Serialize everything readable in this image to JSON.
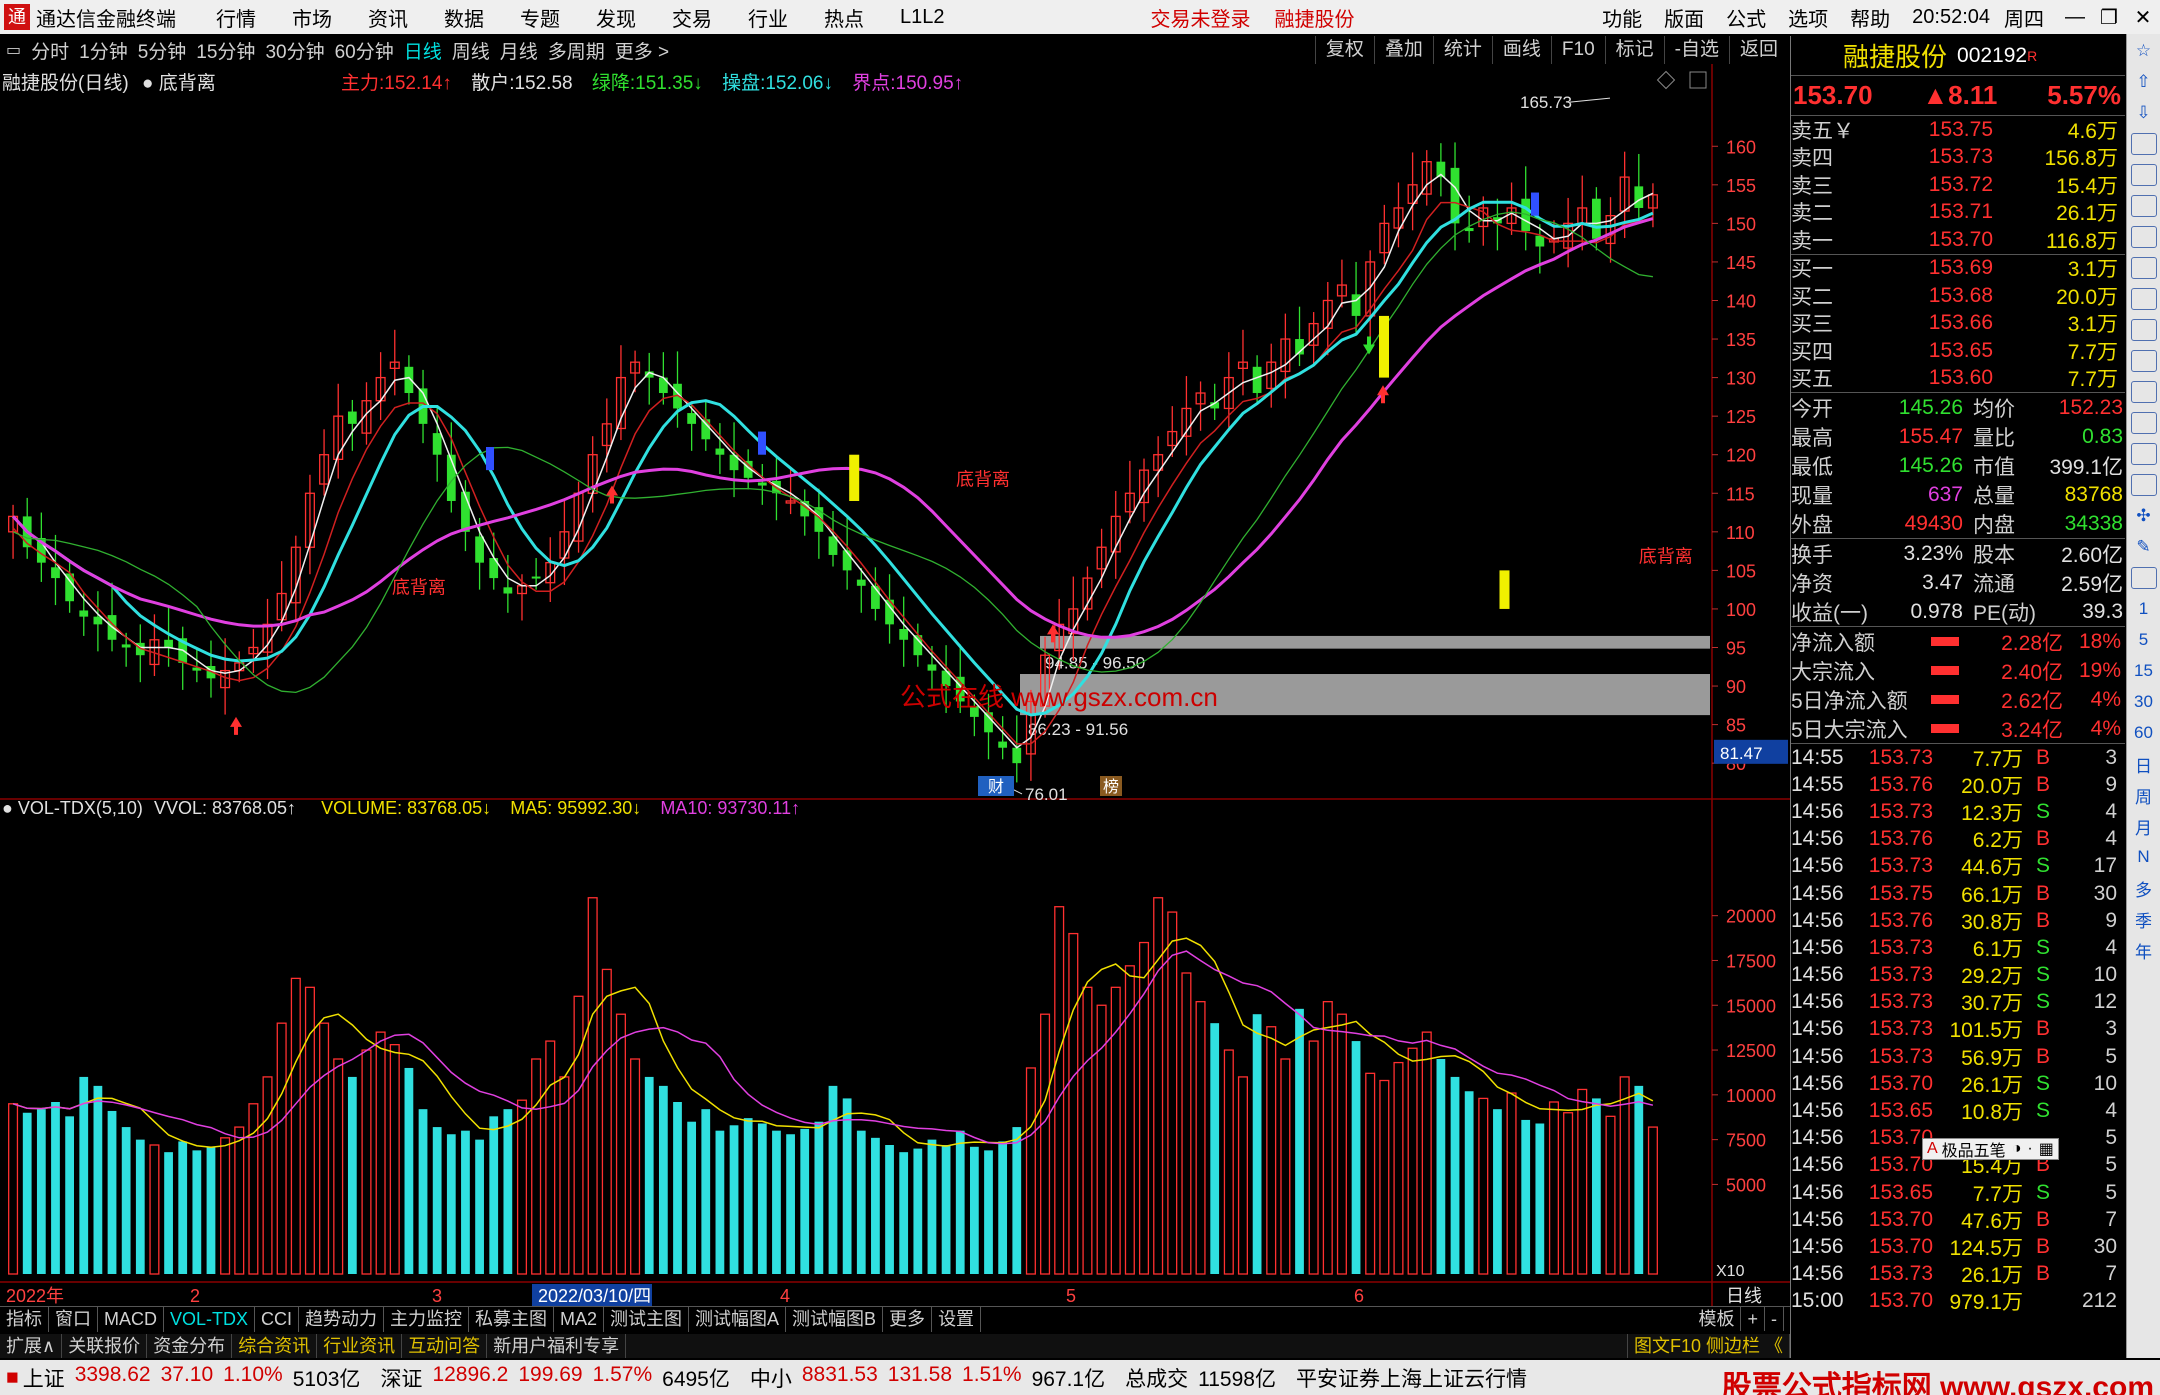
{
  "app_title": "通达信金融终端",
  "menu": [
    "行情",
    "市场",
    "资讯",
    "数据",
    "专题",
    "发现",
    "交易",
    "行业",
    "热点",
    "L1L2"
  ],
  "status_login": "交易未登录",
  "stock_short": "融捷股份",
  "top_right_menu": [
    "功能",
    "版面",
    "公式",
    "选项",
    "帮助"
  ],
  "clock": "20:52:04",
  "weekday": "周四",
  "window_buttons": [
    "—",
    "❐",
    "✕"
  ],
  "periods": [
    "分时",
    "1分钟",
    "5分钟",
    "15分钟",
    "30分钟",
    "60分钟",
    "日线",
    "周线",
    "月线",
    "多周期",
    "更多 >"
  ],
  "active_period": "日线",
  "chart_tools": [
    "复权",
    "叠加",
    "统计",
    "画线",
    "F10",
    "标记",
    "-自选",
    "返回"
  ],
  "main_legend": {
    "title": "融捷股份(日线)",
    "indicator": "底背离",
    "zl_label": "主力:",
    "zl_value": "152.14↑",
    "sh_label": "散户:",
    "sh_value": "152.58",
    "lj_label": "绿降:",
    "lj_value": "151.35↓",
    "cp_label": "操盘:",
    "cp_value": "152.06↓",
    "jd_label": "界点:",
    "jd_value": "150.95↑"
  },
  "vol_legend": {
    "name": "VOL-TDX(5,10)",
    "vvol": "VVOL: 83768.05↑",
    "volume": "VOLUME: 83768.05↓",
    "ma5": "MA5: 95992.30↓",
    "ma10": "MA10: 93730.11↑"
  },
  "annotations": {
    "high": "165.73",
    "low": "76.01",
    "zone1": "94.85 - 96.50",
    "zone2": "86.23 - 91.56",
    "div1": "底背离",
    "div2": "底背离",
    "div3": "底背离",
    "badge1": "财",
    "badge2": "榜",
    "price_tag": "81.47",
    "multiplier": "X10",
    "watermark": "公式在线 www.gszx.com.cn"
  },
  "x_labels": [
    "2022年",
    "2",
    "3",
    "2022/03/10/四",
    "4",
    "5",
    "6"
  ],
  "x_axis_period": "日线",
  "indicator_tabs": [
    "指标",
    "窗口",
    "MACD",
    "VOL-TDX",
    "CCI",
    "趋势动力",
    "主力监控",
    "私募主图",
    "MA2",
    "测试主图",
    "测试幅图A",
    "测试幅图B",
    "更多",
    "设置"
  ],
  "active_indicator": "VOL-TDX",
  "tab_right": [
    "模板",
    "+",
    "-"
  ],
  "ext_tabs": [
    "扩展∧",
    "关联报价",
    "资金分布",
    "综合资讯",
    "行业资讯",
    "互动问答",
    "新用户福利专享"
  ],
  "ext_right": "图文F10 侧边栏 《",
  "statusbar": {
    "sh_label": "上证",
    "sh": "3398.62",
    "sh_chg": "37.10",
    "sh_pct": "1.10%",
    "sh_amt": "5103亿",
    "sz_label": "深证",
    "sz": "12896.2",
    "sz_chg": "199.69",
    "sz_pct": "1.57%",
    "sz_amt": "6495亿",
    "zx_label": "中小",
    "zx": "8831.53",
    "zx_chg": "131.58",
    "zx_pct": "1.51%",
    "zx_amt": "967.1亿",
    "total_label": "总成交",
    "total": "11598亿",
    "note": "平安证券上海上证云行情",
    "watermark": "股票公式指标网 www.gszx.com"
  },
  "quote": {
    "name": "融捷股份",
    "code": "002192",
    "flag": "R",
    "price": "153.70",
    "change": "▲8.11",
    "pct": "5.57%",
    "asks": [
      {
        "label": "卖五￥",
        "price": "153.75",
        "vol": "4.6万"
      },
      {
        "label": "卖四",
        "price": "153.73",
        "vol": "156.8万"
      },
      {
        "label": "卖三",
        "price": "153.72",
        "vol": "15.4万"
      },
      {
        "label": "卖二",
        "price": "153.71",
        "vol": "26.1万"
      },
      {
        "label": "卖一",
        "price": "153.70",
        "vol": "116.8万"
      }
    ],
    "bids": [
      {
        "label": "买一",
        "price": "153.69",
        "vol": "3.1万"
      },
      {
        "label": "买二",
        "price": "153.68",
        "vol": "20.0万"
      },
      {
        "label": "买三",
        "price": "153.66",
        "vol": "3.1万"
      },
      {
        "label": "买四",
        "price": "153.65",
        "vol": "7.7万"
      },
      {
        "label": "买五",
        "price": "153.60",
        "vol": "7.7万"
      }
    ],
    "stats1": [
      {
        "l1": "今开",
        "v1": "145.26",
        "c1": "#30e030",
        "l2": "均价",
        "v2": "152.23",
        "c2": "#ff3030"
      },
      {
        "l1": "最高",
        "v1": "155.47",
        "c1": "#ff3030",
        "l2": "量比",
        "v2": "0.83",
        "c2": "#30e030"
      },
      {
        "l1": "最低",
        "v1": "145.26",
        "c1": "#30e030",
        "l2": "市值",
        "v2": "399.1亿",
        "c2": "#e0e0e0"
      },
      {
        "l1": "现量",
        "v1": "637",
        "c1": "#e040e0",
        "l2": "总量",
        "v2": "83768",
        "c2": "#f0e000"
      },
      {
        "l1": "外盘",
        "v1": "49430",
        "c1": "#ff3030",
        "l2": "内盘",
        "v2": "34338",
        "c2": "#30e030"
      }
    ],
    "stats2": [
      {
        "l1": "换手",
        "v1": "3.23%",
        "c1": "#e0e0e0",
        "l2": "股本",
        "v2": "2.60亿",
        "c2": "#e0e0e0"
      },
      {
        "l1": "净资",
        "v1": "3.47",
        "c1": "#e0e0e0",
        "l2": "流通",
        "v2": "2.59亿",
        "c2": "#e0e0e0"
      },
      {
        "l1": "收益(一)",
        "v1": "0.978",
        "c1": "#e0e0e0",
        "l2": "PE(动)",
        "v2": "39.3",
        "c2": "#e0e0e0"
      }
    ],
    "flows": [
      {
        "label": "净流入额",
        "val": "2.28亿",
        "pct": "18%"
      },
      {
        "label": "大宗流入",
        "val": "2.40亿",
        "pct": "19%"
      },
      {
        "label": "5日净流入额",
        "val": "2.62亿",
        "pct": "4%"
      },
      {
        "label": "5日大宗流入",
        "val": "3.24亿",
        "pct": "4%"
      }
    ],
    "ticks": [
      {
        "t": "14:55",
        "p": "153.73",
        "v": "7.7万",
        "s": "B",
        "n": "3"
      },
      {
        "t": "14:55",
        "p": "153.76",
        "v": "20.0万",
        "s": "B",
        "n": "9"
      },
      {
        "t": "14:56",
        "p": "153.73",
        "v": "12.3万",
        "s": "S",
        "n": "4"
      },
      {
        "t": "14:56",
        "p": "153.76",
        "v": "6.2万",
        "s": "B",
        "n": "4"
      },
      {
        "t": "14:56",
        "p": "153.73",
        "v": "44.6万",
        "s": "S",
        "n": "17"
      },
      {
        "t": "14:56",
        "p": "153.75",
        "v": "66.1万",
        "s": "B",
        "n": "30"
      },
      {
        "t": "14:56",
        "p": "153.76",
        "v": "30.8万",
        "s": "B",
        "n": "9"
      },
      {
        "t": "14:56",
        "p": "153.73",
        "v": "6.1万",
        "s": "S",
        "n": "4"
      },
      {
        "t": "14:56",
        "p": "153.73",
        "v": "29.2万",
        "s": "S",
        "n": "10"
      },
      {
        "t": "14:56",
        "p": "153.73",
        "v": "30.7万",
        "s": "S",
        "n": "12"
      },
      {
        "t": "14:56",
        "p": "153.73",
        "v": "101.5万",
        "s": "B",
        "n": "3"
      },
      {
        "t": "14:56",
        "p": "153.73",
        "v": "56.9万",
        "s": "B",
        "n": "5"
      },
      {
        "t": "14:56",
        "p": "153.70",
        "v": "26.1万",
        "s": "S",
        "n": "10"
      },
      {
        "t": "14:56",
        "p": "153.65",
        "v": "10.8万",
        "s": "S",
        "n": "4"
      },
      {
        "t": "14:56",
        "p": "153.70",
        "v": "",
        "s": "",
        "n": "5"
      },
      {
        "t": "14:56",
        "p": "153.70",
        "v": "15.4万",
        "s": "B",
        "n": "5"
      },
      {
        "t": "14:56",
        "p": "153.65",
        "v": "7.7万",
        "s": "S",
        "n": "5"
      },
      {
        "t": "14:56",
        "p": "153.70",
        "v": "47.6万",
        "s": "B",
        "n": "7"
      },
      {
        "t": "14:56",
        "p": "153.70",
        "v": "124.5万",
        "s": "B",
        "n": "30"
      },
      {
        "t": "14:56",
        "p": "153.73",
        "v": "26.1万",
        "s": "B",
        "n": "7"
      },
      {
        "t": "15:00",
        "p": "153.70",
        "v": "979.1万",
        "s": "",
        "n": "212"
      }
    ]
  },
  "ime_bar": "极品五笔",
  "sidebar_labels": [
    "日",
    "周",
    "月",
    "N",
    "多",
    "季",
    "年"
  ],
  "chart_data": {
    "type": "candlestick",
    "price_axis": {
      "ticks": [
        80,
        85,
        90,
        95,
        100,
        105,
        110,
        115,
        120,
        125,
        130,
        135,
        140,
        145,
        150,
        155,
        160
      ],
      "ylim": [
        76,
        166
      ]
    },
    "volume_axis": {
      "ticks": [
        5000,
        7500,
        10000,
        12500,
        15000,
        17500,
        20000
      ],
      "ylim": [
        0,
        24000
      ]
    },
    "closes": [
      112,
      108,
      106,
      104,
      101,
      99,
      98,
      96,
      95,
      94,
      96,
      95,
      93,
      92,
      91,
      92,
      93,
      95,
      98,
      102,
      108,
      115,
      120,
      125,
      124,
      127,
      130,
      132,
      128,
      124,
      120,
      114,
      110,
      106,
      104,
      102,
      103,
      104,
      106,
      110,
      115,
      120,
      124,
      130,
      132,
      130,
      128,
      126,
      124,
      122,
      120,
      118,
      117,
      116,
      115,
      114,
      112,
      110,
      107,
      105,
      103,
      100,
      98,
      96,
      94,
      92,
      90,
      88,
      86,
      84,
      82,
      80,
      88,
      94,
      98,
      100,
      104,
      108,
      112,
      115,
      118,
      120,
      123,
      126,
      128,
      126,
      130,
      132,
      128,
      132,
      135,
      133,
      137,
      140,
      142,
      138,
      145,
      150,
      152,
      155,
      158,
      156,
      150,
      149,
      152,
      150,
      152,
      149,
      147,
      148,
      150,
      152,
      148,
      151,
      156,
      152,
      153.7
    ],
    "volumes": [
      9500,
      9000,
      9200,
      9600,
      8800,
      11000,
      10500,
      9100,
      8200,
      7500,
      7200,
      6800,
      7400,
      6900,
      7100,
      7600,
      8200,
      9500,
      11000,
      14000,
      16500,
      16000,
      14000,
      12000,
      11000,
      12500,
      13500,
      12800,
      11500,
      9200,
      8200,
      7800,
      8000,
      7500,
      8800,
      9200,
      9700,
      12000,
      13000,
      11000,
      15500,
      21000,
      17000,
      14500,
      12000,
      11000,
      10500,
      9600,
      8500,
      9200,
      8000,
      8300,
      8700,
      8400,
      8000,
      7800,
      8100,
      8500,
      10500,
      9800,
      8000,
      7600,
      7200,
      6800,
      7000,
      7500,
      7200,
      8000,
      7100,
      6900,
      7400,
      8200,
      11500,
      14500,
      20500,
      19000,
      16000,
      15000,
      16000,
      17200,
      18500,
      21000,
      20200,
      16800,
      15200,
      14000,
      12500,
      11000,
      14500,
      13800,
      12000,
      14800,
      13000,
      15200,
      14500,
      13000,
      11200,
      10800,
      11800,
      12600,
      13500,
      12000,
      11000,
      10200,
      9800,
      9200,
      10100,
      8600,
      8400,
      9600,
      9000,
      10300,
      9800,
      8800,
      11000,
      10500,
      8200
    ],
    "series": [
      {
        "name": "VOLUME",
        "values_ref": "volumes"
      },
      {
        "name": "MA5",
        "last": "95992.30"
      },
      {
        "name": "MA10",
        "last": "93730.11"
      }
    ]
  }
}
